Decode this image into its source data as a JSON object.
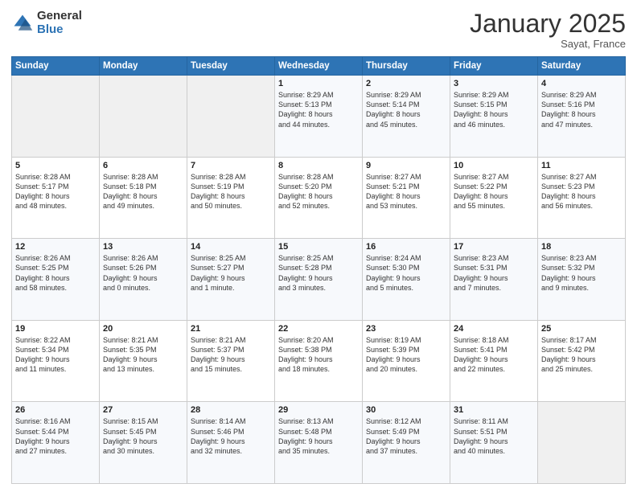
{
  "logo": {
    "general": "General",
    "blue": "Blue"
  },
  "title": "January 2025",
  "location": "Sayat, France",
  "days_header": [
    "Sunday",
    "Monday",
    "Tuesday",
    "Wednesday",
    "Thursday",
    "Friday",
    "Saturday"
  ],
  "weeks": [
    [
      {
        "day": "",
        "content": ""
      },
      {
        "day": "",
        "content": ""
      },
      {
        "day": "",
        "content": ""
      },
      {
        "day": "1",
        "content": "Sunrise: 8:29 AM\nSunset: 5:13 PM\nDaylight: 8 hours\nand 44 minutes."
      },
      {
        "day": "2",
        "content": "Sunrise: 8:29 AM\nSunset: 5:14 PM\nDaylight: 8 hours\nand 45 minutes."
      },
      {
        "day": "3",
        "content": "Sunrise: 8:29 AM\nSunset: 5:15 PM\nDaylight: 8 hours\nand 46 minutes."
      },
      {
        "day": "4",
        "content": "Sunrise: 8:29 AM\nSunset: 5:16 PM\nDaylight: 8 hours\nand 47 minutes."
      }
    ],
    [
      {
        "day": "5",
        "content": "Sunrise: 8:28 AM\nSunset: 5:17 PM\nDaylight: 8 hours\nand 48 minutes."
      },
      {
        "day": "6",
        "content": "Sunrise: 8:28 AM\nSunset: 5:18 PM\nDaylight: 8 hours\nand 49 minutes."
      },
      {
        "day": "7",
        "content": "Sunrise: 8:28 AM\nSunset: 5:19 PM\nDaylight: 8 hours\nand 50 minutes."
      },
      {
        "day": "8",
        "content": "Sunrise: 8:28 AM\nSunset: 5:20 PM\nDaylight: 8 hours\nand 52 minutes."
      },
      {
        "day": "9",
        "content": "Sunrise: 8:27 AM\nSunset: 5:21 PM\nDaylight: 8 hours\nand 53 minutes."
      },
      {
        "day": "10",
        "content": "Sunrise: 8:27 AM\nSunset: 5:22 PM\nDaylight: 8 hours\nand 55 minutes."
      },
      {
        "day": "11",
        "content": "Sunrise: 8:27 AM\nSunset: 5:23 PM\nDaylight: 8 hours\nand 56 minutes."
      }
    ],
    [
      {
        "day": "12",
        "content": "Sunrise: 8:26 AM\nSunset: 5:25 PM\nDaylight: 8 hours\nand 58 minutes."
      },
      {
        "day": "13",
        "content": "Sunrise: 8:26 AM\nSunset: 5:26 PM\nDaylight: 9 hours\nand 0 minutes."
      },
      {
        "day": "14",
        "content": "Sunrise: 8:25 AM\nSunset: 5:27 PM\nDaylight: 9 hours\nand 1 minute."
      },
      {
        "day": "15",
        "content": "Sunrise: 8:25 AM\nSunset: 5:28 PM\nDaylight: 9 hours\nand 3 minutes."
      },
      {
        "day": "16",
        "content": "Sunrise: 8:24 AM\nSunset: 5:30 PM\nDaylight: 9 hours\nand 5 minutes."
      },
      {
        "day": "17",
        "content": "Sunrise: 8:23 AM\nSunset: 5:31 PM\nDaylight: 9 hours\nand 7 minutes."
      },
      {
        "day": "18",
        "content": "Sunrise: 8:23 AM\nSunset: 5:32 PM\nDaylight: 9 hours\nand 9 minutes."
      }
    ],
    [
      {
        "day": "19",
        "content": "Sunrise: 8:22 AM\nSunset: 5:34 PM\nDaylight: 9 hours\nand 11 minutes."
      },
      {
        "day": "20",
        "content": "Sunrise: 8:21 AM\nSunset: 5:35 PM\nDaylight: 9 hours\nand 13 minutes."
      },
      {
        "day": "21",
        "content": "Sunrise: 8:21 AM\nSunset: 5:37 PM\nDaylight: 9 hours\nand 15 minutes."
      },
      {
        "day": "22",
        "content": "Sunrise: 8:20 AM\nSunset: 5:38 PM\nDaylight: 9 hours\nand 18 minutes."
      },
      {
        "day": "23",
        "content": "Sunrise: 8:19 AM\nSunset: 5:39 PM\nDaylight: 9 hours\nand 20 minutes."
      },
      {
        "day": "24",
        "content": "Sunrise: 8:18 AM\nSunset: 5:41 PM\nDaylight: 9 hours\nand 22 minutes."
      },
      {
        "day": "25",
        "content": "Sunrise: 8:17 AM\nSunset: 5:42 PM\nDaylight: 9 hours\nand 25 minutes."
      }
    ],
    [
      {
        "day": "26",
        "content": "Sunrise: 8:16 AM\nSunset: 5:44 PM\nDaylight: 9 hours\nand 27 minutes."
      },
      {
        "day": "27",
        "content": "Sunrise: 8:15 AM\nSunset: 5:45 PM\nDaylight: 9 hours\nand 30 minutes."
      },
      {
        "day": "28",
        "content": "Sunrise: 8:14 AM\nSunset: 5:46 PM\nDaylight: 9 hours\nand 32 minutes."
      },
      {
        "day": "29",
        "content": "Sunrise: 8:13 AM\nSunset: 5:48 PM\nDaylight: 9 hours\nand 35 minutes."
      },
      {
        "day": "30",
        "content": "Sunrise: 8:12 AM\nSunset: 5:49 PM\nDaylight: 9 hours\nand 37 minutes."
      },
      {
        "day": "31",
        "content": "Sunrise: 8:11 AM\nSunset: 5:51 PM\nDaylight: 9 hours\nand 40 minutes."
      },
      {
        "day": "",
        "content": ""
      }
    ]
  ]
}
